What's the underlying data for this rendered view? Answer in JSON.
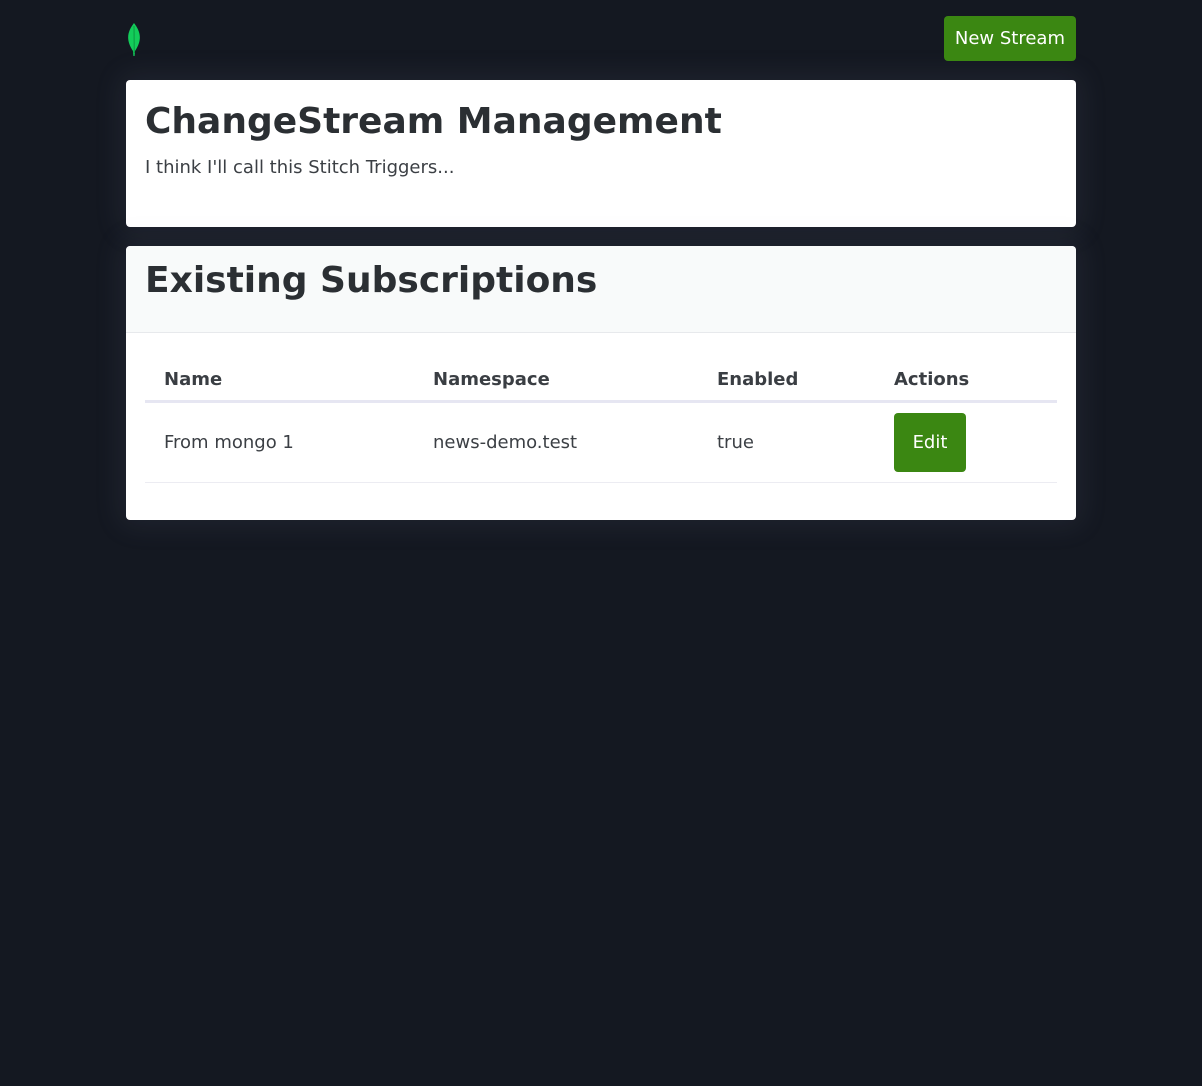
{
  "navbar": {
    "logo_icon": "mongodb-leaf-icon",
    "logo_color": "#13aa52",
    "new_stream_label": "New Stream"
  },
  "intro": {
    "title": "ChangeStream Management",
    "text": "I think I'll call this Stitch Triggers..."
  },
  "subscriptions": {
    "title": "Existing Subscriptions",
    "columns": [
      "Name",
      "Namespace",
      "Enabled",
      "Actions"
    ],
    "rows": [
      {
        "name": "From mongo 1",
        "namespace": "news-demo.test",
        "enabled": "true",
        "action_label": "Edit"
      }
    ]
  },
  "colors": {
    "background": "#141821",
    "accent_green": "#3b8712",
    "card": "#ffffff"
  }
}
